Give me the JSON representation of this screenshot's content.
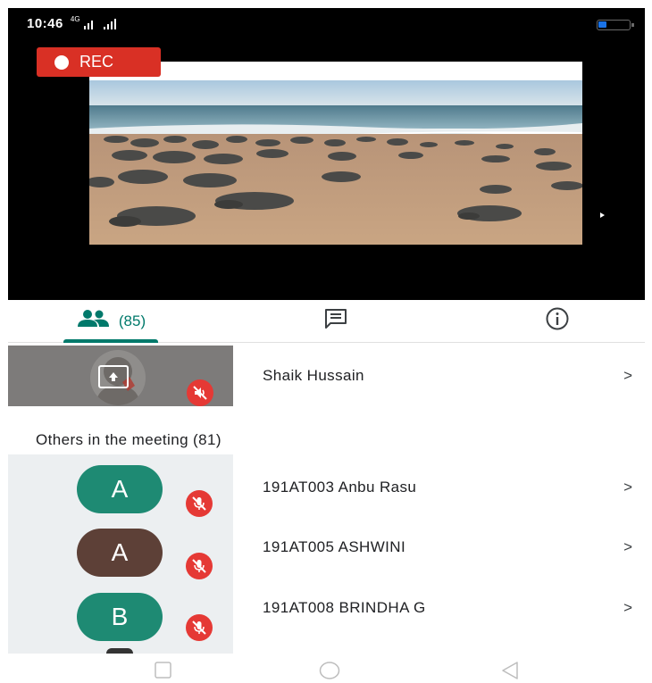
{
  "status_bar": {
    "time": "10:46",
    "network": "4G"
  },
  "recording": {
    "label": "REC",
    "color": "#d93025"
  },
  "tabs": {
    "people_count": "(85)",
    "active_tab": "people",
    "accent_color": "#00796b"
  },
  "presenter": {
    "name": "Shaik Hussain",
    "chevron": ">",
    "icons": [
      "present-screen-icon",
      "mic-off-icon"
    ]
  },
  "others": {
    "label": "Others in the meeting (81)"
  },
  "participants": [
    {
      "initial": "A",
      "name": "191AT003 Anbu Rasu",
      "chevron": ">",
      "avatar_color": "#1e8a73"
    },
    {
      "initial": "A",
      "name": "191AT005 ASHWINI",
      "chevron": ">",
      "avatar_color": "#5d4037"
    },
    {
      "initial": "B",
      "name": "191AT008 BRINDHA G",
      "chevron": ">",
      "avatar_color": "#1e8a73"
    }
  ],
  "mute_color": "#e53935",
  "nav_icons": [
    "recent-apps-icon",
    "home-icon",
    "back-icon"
  ]
}
